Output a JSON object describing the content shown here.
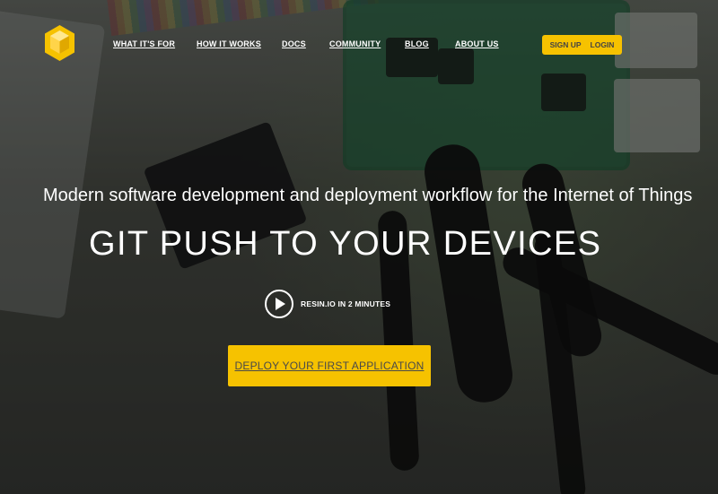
{
  "nav": {
    "items": [
      {
        "label": "WHAT IT'S FOR"
      },
      {
        "label": "HOW IT WORKS"
      },
      {
        "label": "DOCS"
      },
      {
        "label": "COMMUNITY"
      },
      {
        "label": "BLOG"
      },
      {
        "label": "ABOUT US"
      }
    ],
    "auth": {
      "signup": "SIGN UP",
      "login": "LOGIN"
    }
  },
  "hero": {
    "tagline": "Modern software development and deployment workflow for the Internet of Things",
    "headline": "GIT PUSH TO YOUR DEVICES",
    "video_label": "RESIN.IO IN 2 MINUTES",
    "cta": "DEPLOY YOUR FIRST APPLICATION"
  },
  "colors": {
    "accent": "#f6c200",
    "text": "#ffffff",
    "cta_text": "#4a4a4a"
  },
  "icons": {
    "logo": "resin-cube-logo-icon",
    "play": "play-icon"
  }
}
